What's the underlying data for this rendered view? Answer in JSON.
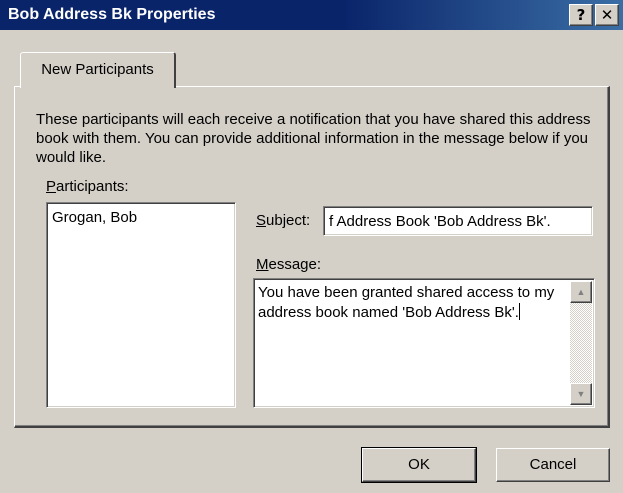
{
  "window": {
    "title": "Bob Address Bk Properties",
    "help_button": "?",
    "close_button": "✕"
  },
  "tab": {
    "label": "New Participants"
  },
  "description": "These participants will each receive a notification that you have shared this address book with them.  You can provide additional information in the message below if you would like.",
  "participants": {
    "label_accel": "P",
    "label_rest": "articipants:",
    "items": [
      "Grogan, Bob"
    ]
  },
  "subject": {
    "label_accel": "S",
    "label_rest": "ubject:",
    "value": "f Address Book 'Bob Address Bk'."
  },
  "message": {
    "label_accel": "M",
    "label_rest": "essage:",
    "value": "You have been granted shared access to my address book named 'Bob Address Bk'."
  },
  "buttons": {
    "ok": "OK",
    "cancel": "Cancel"
  },
  "icons": {
    "scroll_up": "▲",
    "scroll_down": "▼"
  }
}
